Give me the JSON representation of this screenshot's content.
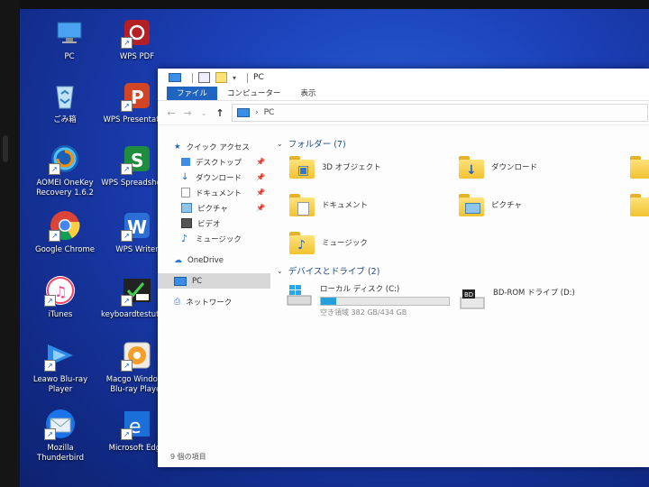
{
  "desktop_icons": [
    {
      "label": "PC",
      "icon": "pc-icon"
    },
    {
      "label": "ごみ箱",
      "icon": "recycle-bin-icon"
    },
    {
      "label": "AOMEI OneKey",
      "label2": "Recovery 1.6.2",
      "icon": "aomei-icon"
    },
    {
      "label": "Google Chrome",
      "icon": "chrome-icon"
    },
    {
      "label": "iTunes",
      "icon": "itunes-icon"
    },
    {
      "label": "Leawo Blu-ray",
      "label2": "Player",
      "icon": "leawo-icon"
    },
    {
      "label": "Mozilla",
      "label2": "Thunderbird",
      "icon": "thunderbird-icon"
    },
    {
      "label": "WPS PDF",
      "icon": "wps-pdf-icon"
    },
    {
      "label": "WPS Presentation",
      "icon": "wps-presentation-icon"
    },
    {
      "label": "WPS Spreadsheets",
      "icon": "wps-spreadsheets-icon"
    },
    {
      "label": "WPS Writer",
      "icon": "wps-writer-icon"
    },
    {
      "label": "keyboardtestutility",
      "icon": "keyboard-test-icon"
    },
    {
      "label": "Macgo Windows",
      "label2": "Blu-ray Player",
      "icon": "macgo-icon"
    },
    {
      "label": "Microsoft Edge",
      "icon": "edge-icon"
    }
  ],
  "window": {
    "title": "PC",
    "tabs": [
      {
        "label": "ファイル",
        "active": true
      },
      {
        "label": "コンピューター",
        "active": false
      },
      {
        "label": "表示",
        "active": false
      }
    ],
    "address": {
      "back": "←",
      "forward": "→",
      "recent": "⌄",
      "up": "↑",
      "separator": "›",
      "path": "PC"
    },
    "nav": {
      "quick_access": "クイック アクセス",
      "items": [
        {
          "label": "デスクトップ",
          "pinned": true
        },
        {
          "label": "ダウンロード",
          "pinned": true
        },
        {
          "label": "ドキュメント",
          "pinned": true
        },
        {
          "label": "ピクチャ",
          "pinned": true
        },
        {
          "label": "ビデオ",
          "pinned": false
        },
        {
          "label": "ミュージック",
          "pinned": false
        }
      ],
      "onedrive": "OneDrive",
      "pc": "PC",
      "network": "ネットワーク"
    },
    "folders_header": "フォルダー (7)",
    "folders": [
      "3D オブジェクト",
      "ダウンロード",
      "ドキュメント",
      "ピクチャ",
      "ミュージック"
    ],
    "drives_header": "デバイスとドライブ (2)",
    "drives": [
      {
        "label": "ローカル ディスク (C:)",
        "free": "空き領域 382 GB/434 GB",
        "used_fraction": 0.12
      },
      {
        "label": "BD-ROM ドライブ (D:)"
      }
    ],
    "status": "9 個の項目",
    "colors": {
      "accent": "#1f64c0",
      "bar_fill": "#26a0da"
    }
  }
}
